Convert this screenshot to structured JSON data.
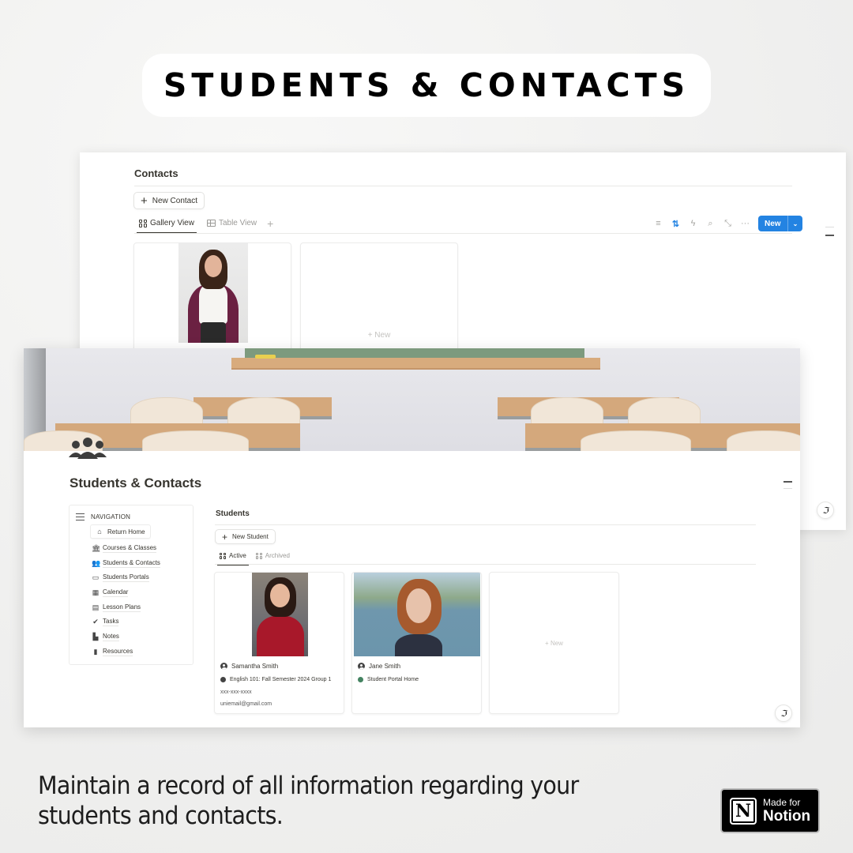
{
  "headline": "STUDENTS & CONTACTS",
  "contacts_window": {
    "title": "Contacts",
    "new_contact_label": "New Contact",
    "tabs": [
      {
        "label": "Gallery View",
        "icon": "gallery-icon",
        "active": true
      },
      {
        "label": "Table View",
        "icon": "table-icon",
        "active": false
      }
    ],
    "add_view_icon": "+",
    "toolbar": {
      "filter_icon": "≡",
      "sort_icon": "⇅",
      "automation_icon": "ϟ",
      "search_icon": "⌕",
      "expand_icon": "⤡",
      "more_icon": "···",
      "new_label": "New",
      "new_chevron": "⌄"
    },
    "cards": [
      {
        "type": "photo",
        "alt": "Contact photo"
      },
      {
        "type": "new",
        "label": "+ New"
      }
    ]
  },
  "students_page": {
    "title": "Students & Contacts",
    "page_icon": "people-group-icon",
    "navigation": {
      "heading": "NAVIGATION",
      "return_home": "Return Home",
      "items": [
        {
          "label": "Courses & Classes",
          "icon": "🏛"
        },
        {
          "label": "Students & Contacts",
          "icon": "👥"
        },
        {
          "label": "Students Portals",
          "icon": "▭"
        },
        {
          "label": "Calendar",
          "icon": "▦"
        },
        {
          "label": "Lesson Plans",
          "icon": "▤"
        },
        {
          "label": "Tasks",
          "icon": "✔"
        },
        {
          "label": "Notes",
          "icon": "▙"
        },
        {
          "label": "Resources",
          "icon": "▮"
        }
      ]
    },
    "students": {
      "title": "Students",
      "new_student_label": "New Student",
      "tabs": [
        {
          "label": "Active",
          "active": true
        },
        {
          "label": "Archived",
          "active": false
        }
      ],
      "cards": [
        {
          "name": "Samantha Smith",
          "course": "English 101: Fall Semester 2024 Group 1",
          "course_icon_color": "#444444",
          "phone": "xxx-xxx-xxxx",
          "email": "uniemail@gmail.com"
        },
        {
          "name": "Jane Smith",
          "portal": "Student Portal Home",
          "portal_icon_color": "#448361"
        }
      ],
      "new_card_label": "+ New"
    }
  },
  "caption": "Maintain a record of all information regarding your students and contacts.",
  "badge": {
    "logo": "N",
    "line1": "Made for",
    "line2": "Notion"
  },
  "colors": {
    "accent_blue": "#2383e2",
    "text": "#37352f",
    "muted": "#9b9a97"
  }
}
